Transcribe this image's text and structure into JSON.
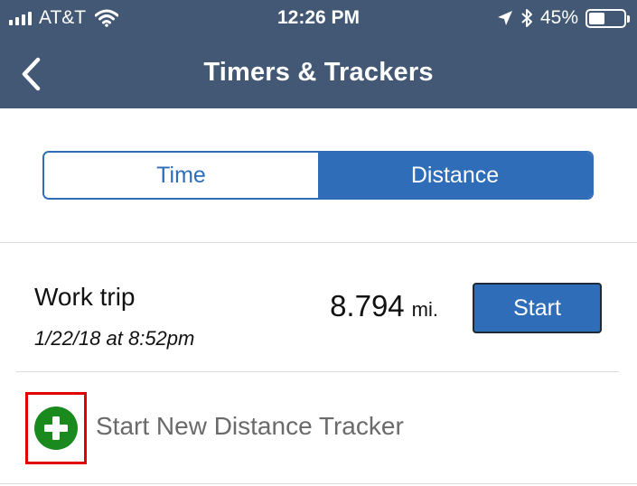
{
  "status_bar": {
    "carrier": "AT&T",
    "time": "12:26 PM",
    "battery_percent": "45%",
    "battery_level": 0.45,
    "icons": [
      "signal-icon",
      "wifi-icon",
      "location-arrow-icon",
      "bluetooth-icon",
      "battery-icon"
    ]
  },
  "nav": {
    "title": "Timers & Trackers",
    "back_icon": "chevron-left-icon"
  },
  "segments": {
    "time_label": "Time",
    "distance_label": "Distance",
    "selected": "Distance"
  },
  "tracker": {
    "name": "Work trip",
    "date": "1/22/18 at 8:52pm",
    "distance_value": "8.794",
    "distance_unit": "mi.",
    "start_label": "Start"
  },
  "add_tracker": {
    "label": "Start New Distance Tracker",
    "icon": "plus-circle-icon"
  },
  "colors": {
    "header": "#435874",
    "accent": "#2f6db8",
    "add_icon": "#1a8a1f",
    "highlight": "#e00000"
  }
}
